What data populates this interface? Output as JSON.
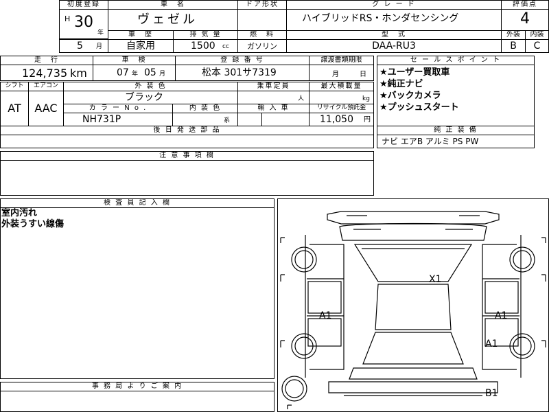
{
  "headers": {
    "first_reg": "初度登録",
    "car_name": "車　名",
    "door": "ドア形状",
    "grade": "グ レ ー ド",
    "score": "評価点",
    "history": "車　歴",
    "displacement": "排 気 量",
    "fuel": "燃　料",
    "model": "型　式",
    "exterior": "外装",
    "interior": "内装",
    "mileage": "走　行",
    "inspection": "車　検",
    "plate": "登 録 番 号",
    "transfer_deadline": "譲渡書類期限",
    "sales_point": "セ ー ル ス ポ イ ン ト",
    "shift": "シフト",
    "aircon": "エアコン",
    "ext_color": "外 装 色",
    "capacity": "乗車定員",
    "max_load": "最大積載量",
    "color_no": "カ ラ ー N o .",
    "int_color": "内 装 色",
    "import": "輸 入 車",
    "recycle": "リサイクル預託金",
    "later_docs": "後 日 発 送 部 品",
    "factory_equip": "純 正 装 備",
    "notes": "注 意 事 項 欄",
    "inspector": "検 査 員 記 入 欄",
    "office": "事 務 局 よ り ご 案 内"
  },
  "values": {
    "era": "H",
    "year": "30",
    "year_unit": "年",
    "month": "5",
    "month_unit": "月",
    "car_name": "ヴェゼル",
    "grade": "ハイブリッドRS・ホンダセンシング",
    "score": "4",
    "history": "自家用",
    "displacement": "1500",
    "displacement_unit": "cc",
    "fuel": "ガソリン",
    "model": "DAA-RU3",
    "exterior_grade": "B",
    "interior_grade": "C",
    "mileage": "124,735",
    "mileage_unit": "km",
    "insp_year": "07",
    "insp_year_unit": "年",
    "insp_month": "05",
    "insp_month_unit": "月",
    "plate": "松本 301サ7319",
    "deadline_month": "月",
    "deadline_day": "日",
    "shift": "AT",
    "aircon": "AAC",
    "ext_color": "ブラック",
    "capacity_unit": "人",
    "load_unit": "kg",
    "color_no": "NH731P",
    "int_color_unit": "系",
    "recycle": "11,050",
    "recycle_unit": "円",
    "equipment": "ナビ エアB アルミ PS PW"
  },
  "sales_points": [
    "★ユーザー買取車",
    "★純正ナビ",
    "★バックカメラ",
    "★プッシュスタート"
  ],
  "inspector_notes": [
    "室内汚れ",
    "外装うすい線傷"
  ],
  "damage_marks": {
    "hood": "X1",
    "left_front_door": "A1",
    "right_front_door": "A1",
    "right_rear_door": "A1",
    "rear": "B1"
  }
}
